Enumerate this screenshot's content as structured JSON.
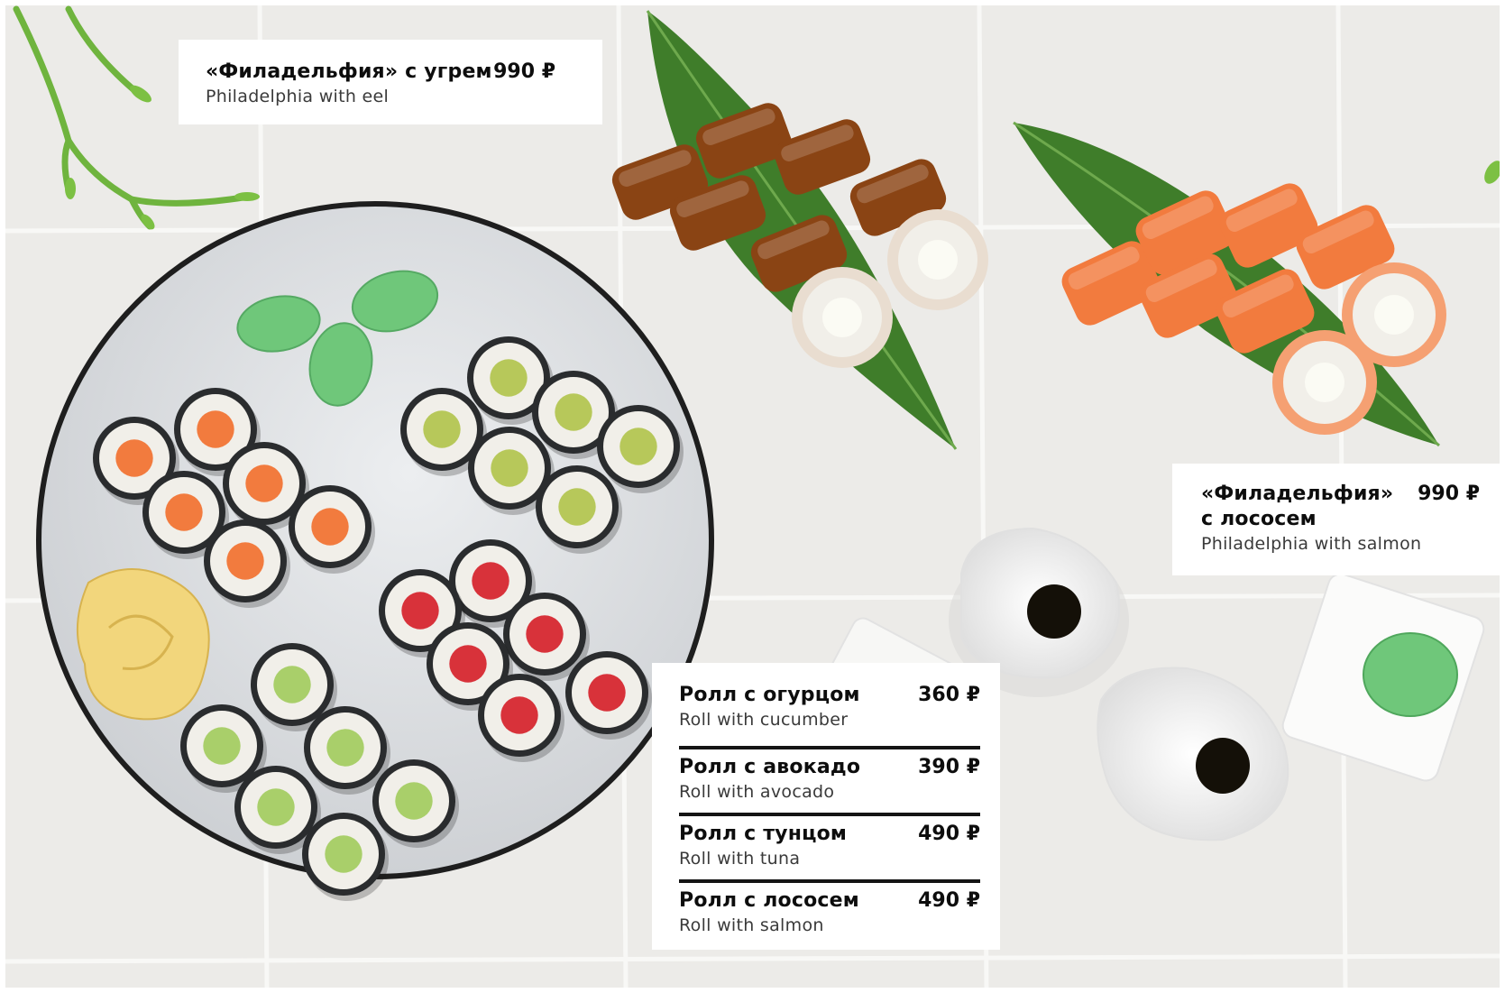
{
  "background_color": "#ecebe8",
  "menu": {
    "philadelphia_eel": {
      "name": "«Филадельфия» с угрем",
      "price": "990 ₽",
      "name_en": "Philadelphia with eel"
    },
    "philadelphia_salmon": {
      "name": "«Филадельфия» с лососем",
      "price": "990 ₽",
      "name_en": "Philadelphia with salmon"
    },
    "rolls": [
      {
        "name": "Ролл с огурцом",
        "price": "360 ₽",
        "name_en": "Roll with cucumber"
      },
      {
        "name": "Ролл с авокадо",
        "price": "390 ₽",
        "name_en": "Roll with avocado"
      },
      {
        "name": "Ролл с тунцом",
        "price": "490 ₽",
        "name_en": "Roll with tuna"
      },
      {
        "name": "Ролл с лососем",
        "price": "490 ₽",
        "name_en": "Roll with salmon"
      }
    ]
  },
  "colors": {
    "salmon": "#f27b3e",
    "tuna": "#d8323a",
    "avocado": "#b7c85a",
    "cucumber": "#a9cf6a",
    "nori": "#2a2c2e",
    "rice": "#f1efe9",
    "wasabi": "#6fc77a",
    "ginger": "#f2d67c",
    "leaf": "#3f7d2a",
    "eel": "#8a4414",
    "plate": "#dcdee0",
    "plate_rim": "#1e1e1e",
    "soy": "#141008"
  }
}
